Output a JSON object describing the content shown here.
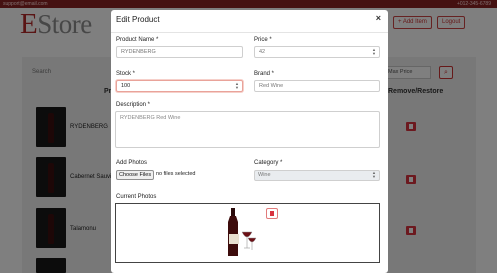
{
  "topbar": {
    "email": "support@email.com",
    "phone": "+012-345-6789"
  },
  "brand": {
    "initial": "E",
    "rest": "Store"
  },
  "header_buttons": {
    "add": "+ Add Item",
    "logout": "Logout"
  },
  "filters": {
    "search_placeholder": "Search",
    "max_price_placeholder": "Max Price"
  },
  "table": {
    "col_product": "Pr",
    "col_action": "Remove/Restore",
    "rows": [
      {
        "name": "RYDENBERG"
      },
      {
        "name": "Cabernet Sauvi"
      },
      {
        "name": "Talamonu"
      },
      {
        "name": ""
      }
    ]
  },
  "modal": {
    "title": "Edit Product",
    "close": "×",
    "product_name": {
      "label": "Product Name *",
      "value": "RYDENBERG"
    },
    "price": {
      "label": "Price *",
      "value": "42"
    },
    "stock": {
      "label": "Stock *",
      "value": "100"
    },
    "brand": {
      "label": "Brand *",
      "value": "Red Wine"
    },
    "description": {
      "label": "Description *",
      "value": "RYDENBERG Red Wine"
    },
    "add_photos": {
      "label": "Add Photos",
      "button": "Choose Files",
      "status": "no files selected"
    },
    "category": {
      "label": "Category *",
      "value": "Wine"
    },
    "current_photos": {
      "label": "Current Photos"
    }
  },
  "colors": {
    "accent": "#b52a2a",
    "danger": "#d9333f"
  }
}
